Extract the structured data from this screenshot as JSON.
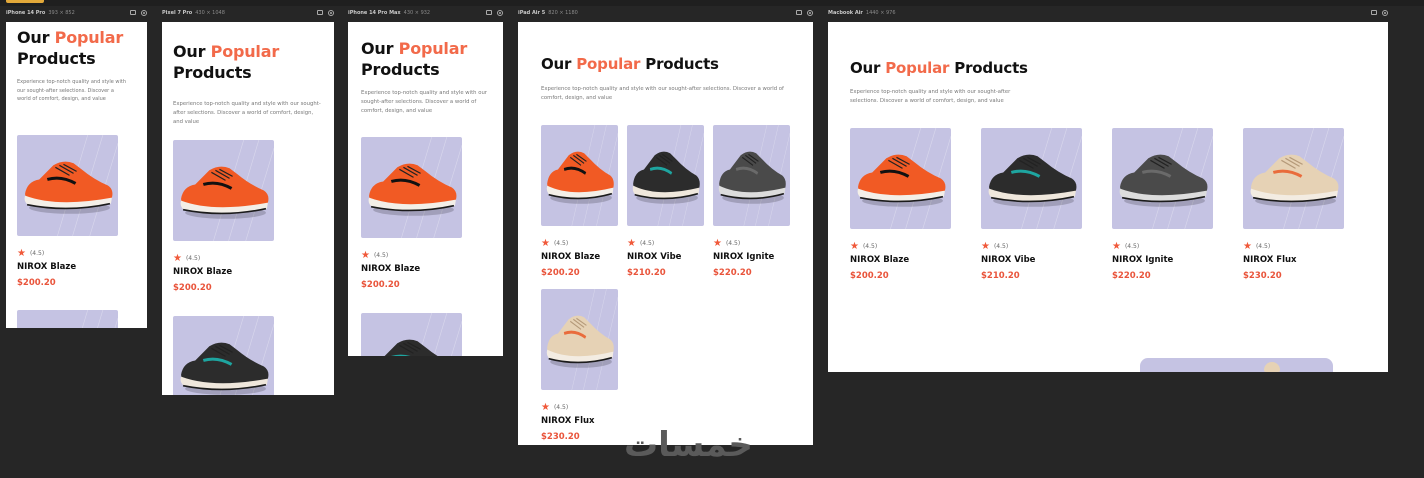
{
  "section": {
    "title_main": "Our",
    "title_accent": "Popular",
    "title_tail": "Products",
    "description": "Experience top-notch quality and style with our sought-after selections. Discover a world of comfort, design, and value"
  },
  "frames": [
    {
      "name": "iPhone 14 Pro",
      "size": "393 × 852"
    },
    {
      "name": "Pixel 7 Pro",
      "size": "430 × 1048"
    },
    {
      "name": "iPhone 14 Pro Max",
      "size": "430 × 932"
    },
    {
      "name": "iPad Air 5",
      "size": "820 × 1180"
    },
    {
      "name": "Macbook Air",
      "size": "1440 × 976"
    }
  ],
  "products": [
    {
      "name": "NIROX Blaze",
      "price": "$200.20",
      "rating": "(4.5)",
      "icon": "shoe-orange-icon",
      "color": "#f15a24"
    },
    {
      "name": "NIROX Vibe",
      "price": "$210.20",
      "rating": "(4.5)",
      "icon": "shoe-black-teal-icon",
      "color": "#2c2c2c"
    },
    {
      "name": "NIROX Ignite",
      "price": "$220.20",
      "rating": "(4.5)",
      "icon": "shoe-grey-icon",
      "color": "#4a4a4a"
    },
    {
      "name": "NIROX Flux",
      "price": "$230.20",
      "rating": "(4.5)",
      "icon": "shoe-beige-icon",
      "color": "#e6d2b5"
    }
  ],
  "colors": {
    "accent": "#f26a4a",
    "card_bg": "#c5c3e3",
    "canvas": "#262626",
    "price": "#e9543b"
  },
  "watermark": "خمسات"
}
